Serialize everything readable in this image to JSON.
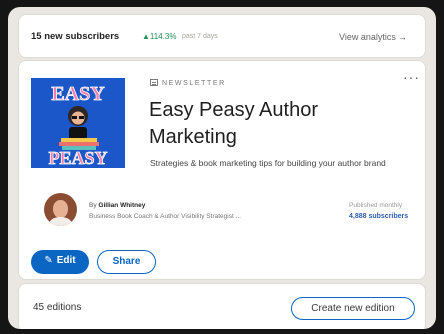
{
  "stats": {
    "subscribers": "15 new subscribers",
    "growth": "▲114.3%",
    "period": "past 7 days",
    "view_analytics": "View analytics"
  },
  "newsletter": {
    "kicker": "NEWSLETTER",
    "more": "···",
    "title": "Easy Peasy Author Marketing",
    "description": "Strategies & book marketing tips for building your author brand",
    "cover_text_top": "EASY",
    "cover_text_bottom": "PEASY",
    "author_by": "By",
    "author_name": "Gillian Whitney",
    "author_role": "Business Book Coach & Author Visibility Strategist ...",
    "frequency": "Published monthly",
    "subscribers": "4,888 subscribers"
  },
  "actions": {
    "edit": "Edit",
    "share": "Share"
  },
  "editions": {
    "count": "45 editions",
    "create": "Create new edition"
  },
  "colors": {
    "accent": "#0a66c2",
    "growth": "#1f8f55",
    "cover": "#1b57c9"
  }
}
